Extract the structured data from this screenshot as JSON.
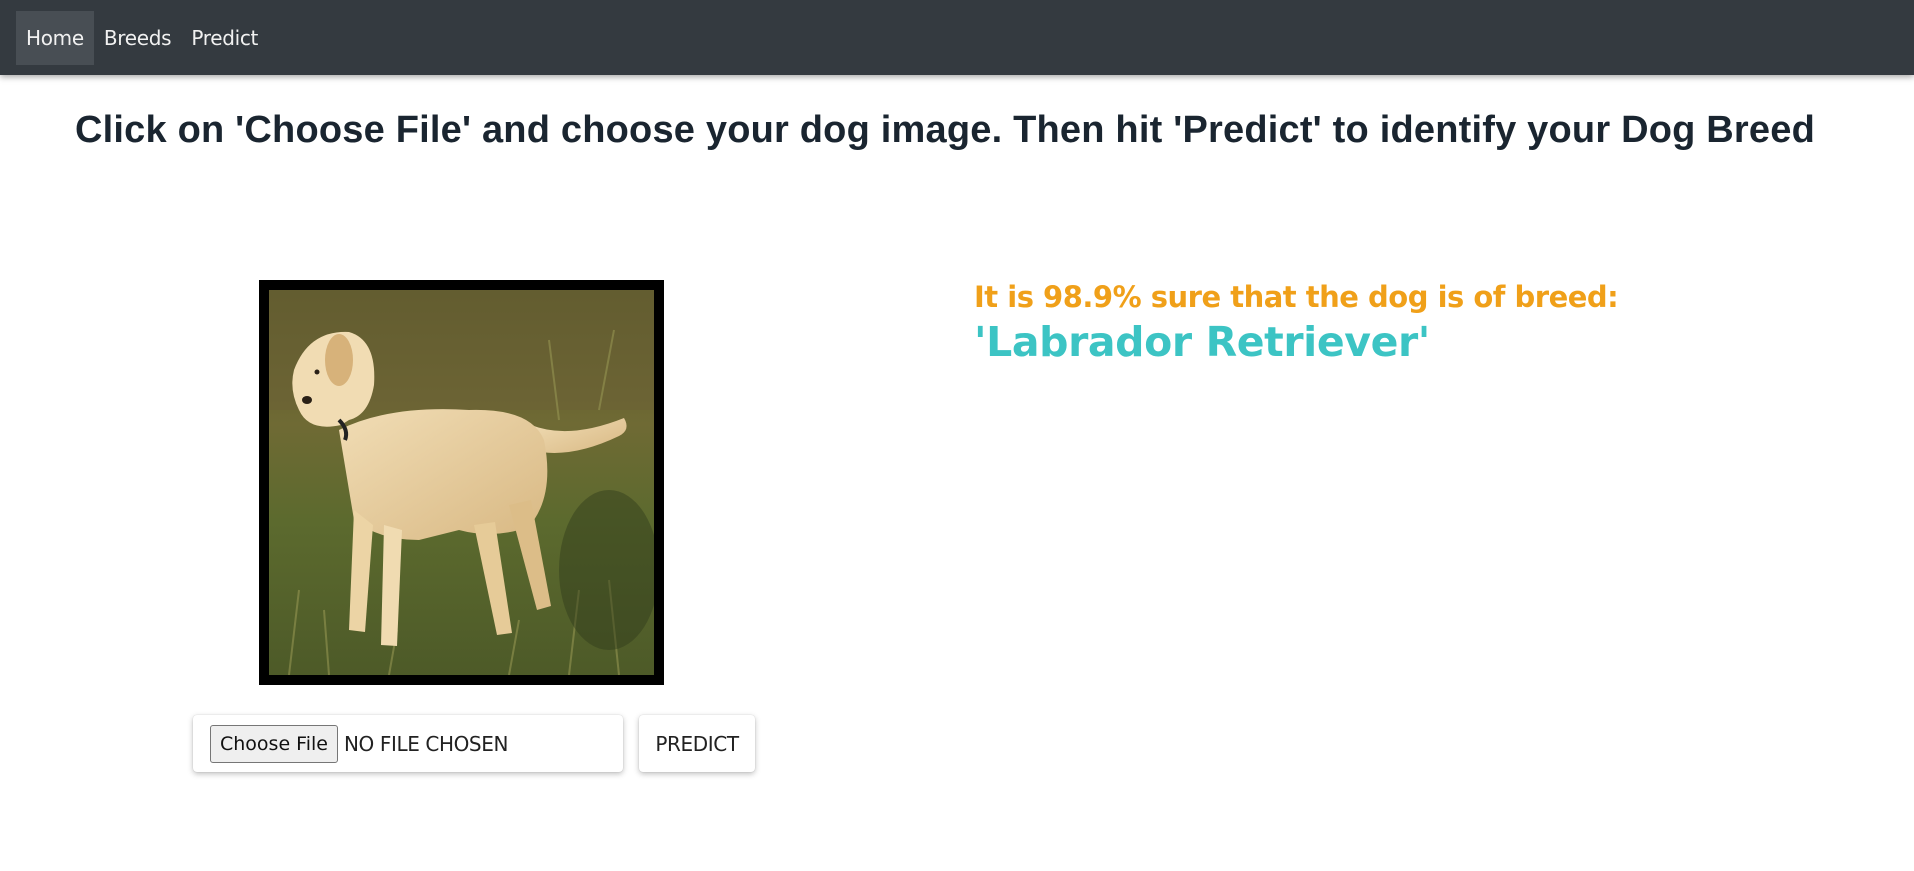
{
  "navbar": {
    "items": [
      {
        "label": "Home",
        "active": true
      },
      {
        "label": "Breeds",
        "active": false
      },
      {
        "label": "Predict",
        "active": false
      }
    ]
  },
  "main": {
    "instruction": "Click on 'Choose File' and choose your dog image. Then hit 'Predict' to identify your Dog Breed",
    "upload": {
      "choose_label": "Choose File",
      "status_text": "NO FILE CHOSEN",
      "predict_label": "PREDICT"
    },
    "result": {
      "confidence_text": "It is 98.9% sure that the dog is of breed:",
      "breed_text": "'Labrador Retriever'"
    }
  },
  "colors": {
    "navbar_bg": "#343a40",
    "confidence": "#f0a019",
    "breed": "#3cc4c4"
  }
}
